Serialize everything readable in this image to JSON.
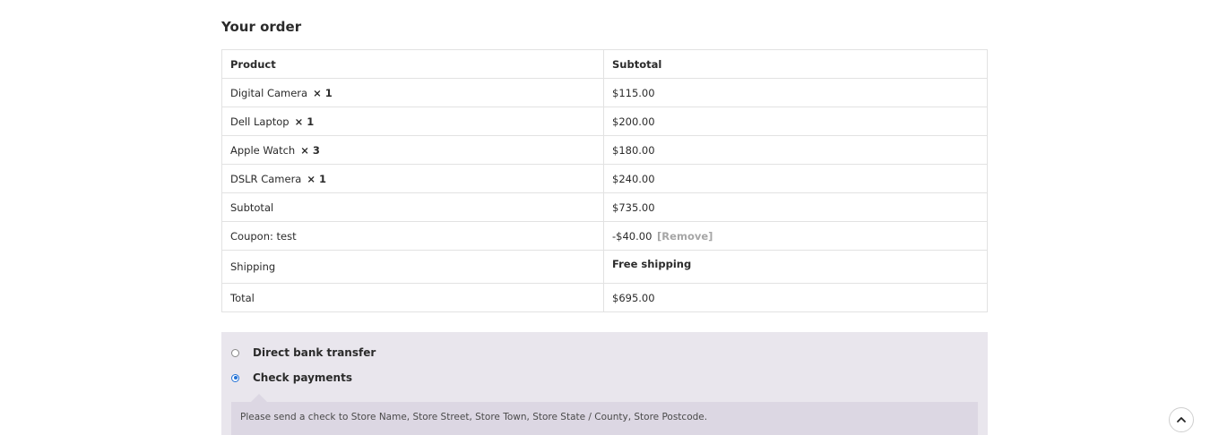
{
  "order": {
    "title": "Your order",
    "headers": {
      "product": "Product",
      "subtotal": "Subtotal"
    },
    "items": [
      {
        "name": "Digital Camera",
        "qty": "× 1",
        "total": "$115.00"
      },
      {
        "name": "Dell Laptop",
        "qty": "× 1",
        "total": "$200.00"
      },
      {
        "name": "Apple Watch",
        "qty": "× 3",
        "total": "$180.00"
      },
      {
        "name": "DSLR Camera",
        "qty": "× 1",
        "total": "$240.00"
      }
    ],
    "subtotal": {
      "label": "Subtotal",
      "value": "$735.00"
    },
    "coupon": {
      "label": "Coupon: test",
      "value": "-$40.00",
      "remove": "[Remove]"
    },
    "shipping": {
      "label": "Shipping",
      "value": "Free shipping"
    },
    "total": {
      "label": "Total",
      "value": "$695.00"
    }
  },
  "payment": {
    "options": [
      {
        "label": "Direct bank transfer",
        "selected": false
      },
      {
        "label": "Check payments",
        "selected": true
      }
    ],
    "description": "Please send a check to Store Name, Store Street, Store Town, Store State / County, Store Postcode."
  },
  "icons": {
    "scroll_top": "chevron-up-icon"
  },
  "colors": {
    "payment_bg": "#e9e6ed",
    "payment_desc_bg": "#dcd7e3",
    "radio_selected": "#2271d6",
    "remove_link": "#a6a6a6"
  }
}
